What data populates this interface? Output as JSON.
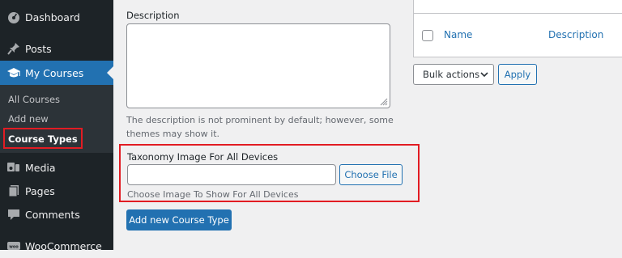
{
  "sidebar": {
    "items": [
      {
        "label": "Dashboard",
        "icon": "dashboard-icon"
      },
      {
        "label": "Posts",
        "icon": "pin-icon"
      },
      {
        "label": "My Courses",
        "icon": "graduation-cap-icon",
        "active": true
      },
      {
        "label": "Media",
        "icon": "media-icon"
      },
      {
        "label": "Pages",
        "icon": "pages-icon"
      },
      {
        "label": "Comments",
        "icon": "comments-icon"
      },
      {
        "label": "WooCommerce",
        "icon": "woo-icon"
      }
    ],
    "submenu": [
      {
        "label": "All Courses"
      },
      {
        "label": "Add new"
      },
      {
        "label": "Course Types",
        "current": true
      }
    ]
  },
  "form": {
    "description_label": "Description",
    "description_value": "",
    "description_help": [
      "The description is not prominent by default; however, some",
      "themes may show it."
    ],
    "taxonomy_image_label": "Taxonomy Image For All Devices",
    "taxonomy_image_value": "",
    "choose_file_label": "Choose File",
    "taxonomy_image_help": "Choose Image To Show For All Devices",
    "submit_label": "Add new Course Type"
  },
  "table": {
    "columns": [
      "Name",
      "Description"
    ],
    "bulk_actions_selected": "Bulk actions",
    "apply_label": "Apply"
  },
  "colors": {
    "sidebar_bg": "#1d2327",
    "accent": "#2271b1",
    "highlight_border": "#e21c23"
  }
}
